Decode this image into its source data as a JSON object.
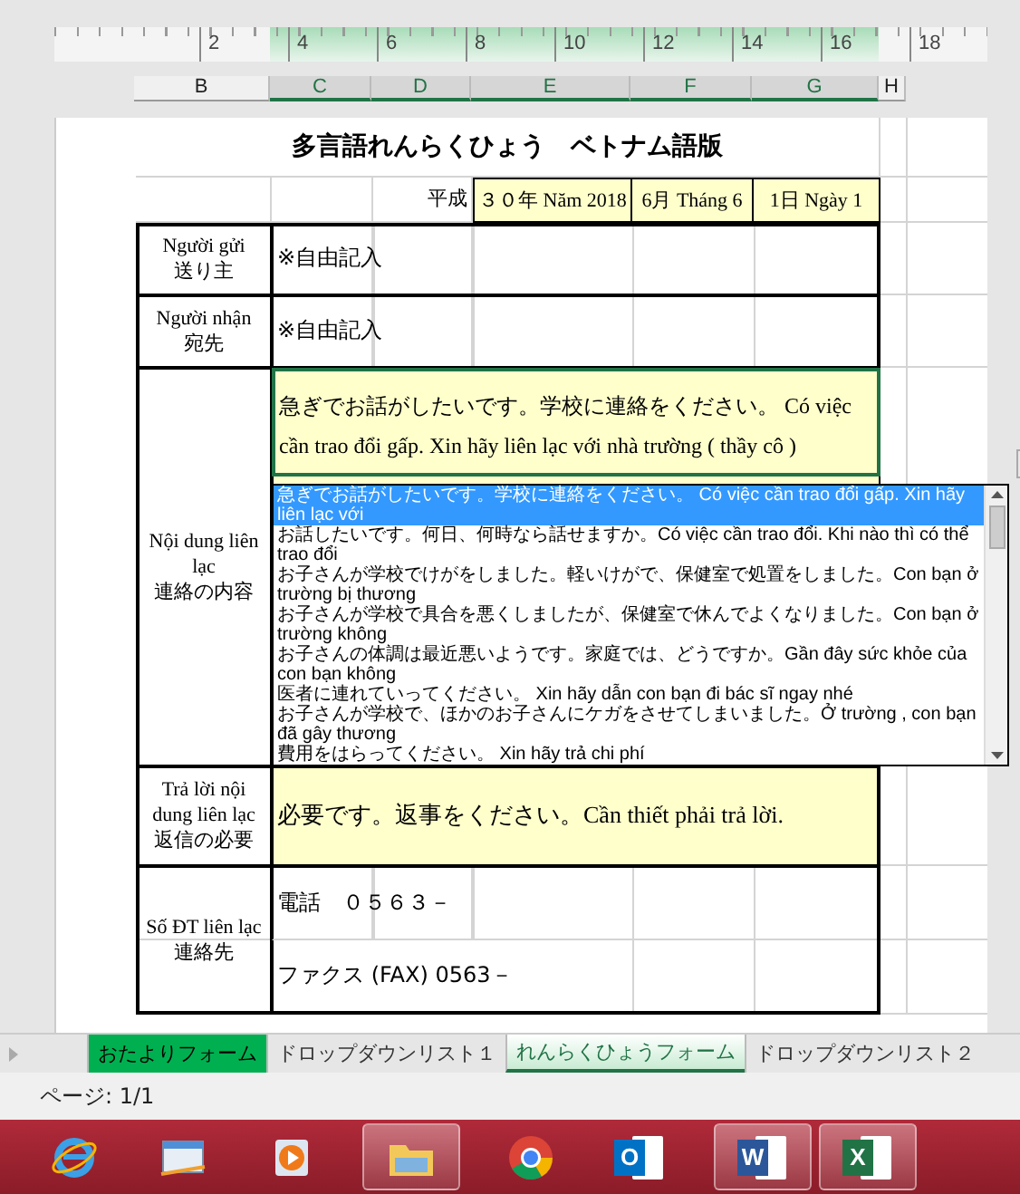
{
  "ruler": {
    "numbers": [
      "2",
      "4",
      "6",
      "8",
      "10",
      "12",
      "14",
      "16",
      "18"
    ]
  },
  "column_headers": [
    {
      "label": "B",
      "selected": false
    },
    {
      "label": "C",
      "selected": true
    },
    {
      "label": "D",
      "selected": true
    },
    {
      "label": "E",
      "selected": true
    },
    {
      "label": "F",
      "selected": true
    },
    {
      "label": "G",
      "selected": true
    },
    {
      "label": "H",
      "selected": false
    }
  ],
  "form": {
    "title": "多言語れんらくひょう　ベトナム語版",
    "date": {
      "era": "平成",
      "year": "３０年 Năm 2018",
      "month": "6月 Tháng 6",
      "day": "1日 Ngày 1"
    },
    "sender": {
      "label": "Người  gửi",
      "label_ja": "送り主",
      "value": "※自由記入"
    },
    "recipient": {
      "label": "Người nhận",
      "label_ja": "宛先",
      "value": "※自由記入"
    },
    "content": {
      "label": "Nội dung liên lạc",
      "label_ja": "連絡の内容",
      "value": "急ぎでお話がしたいです。学校に連絡をください。 Có việc cần trao đổi gấp. Xin hãy liên lạc với nhà trường ( thầy cô )",
      "dropdown": [
        {
          "text": "急ぎでお話がしたいです。学校に連絡をください。 Có việc cần trao đổi gấp. Xin hãy liên lạc với",
          "selected": true
        },
        {
          "text": "お話したいです。何日、何時なら話せますか。Có việc cần trao đổi. Khi nào thì có thể trao đổi",
          "selected": false
        },
        {
          "text": "お子さんが学校でけがをしました。軽いけがで、保健室で処置をしました。Con bạn ở trường bị thương",
          "selected": false
        },
        {
          "text": "お子さんが学校で具合を悪くしましたが、保健室で休んでよくなりました。Con bạn ở trường không",
          "selected": false
        },
        {
          "text": "お子さんの体調は最近悪いようです。家庭では、どうですか。Gần đây sức khỏe của con bạn không",
          "selected": false
        },
        {
          "text": "医者に連れていってください。 Xin hãy dẫn con bạn đi bác sĩ  ngay nhé",
          "selected": false
        },
        {
          "text": "お子さんが学校で、ほかのお子さんにケガをさせてしまいました。Ở trường , con bạn đã gây thương",
          "selected": false
        },
        {
          "text": "費用をはらってください。 Xin hãy trả chi phí",
          "selected": false
        }
      ]
    },
    "reply": {
      "label": "Trả lời nội dung liên lạc",
      "label_ja": "返信の必要",
      "value": "必要です。返事をください。Cần thiết phải trả lời."
    },
    "contact": {
      "label": "Số ĐT liên lạc",
      "label_ja": "連絡先",
      "phone": "電話　０５６３－",
      "fax": "ファクス (FAX)  0563－"
    }
  },
  "sheet_tabs": [
    {
      "label": "おたよりフォーム",
      "selected": false,
      "color": "#00b050"
    },
    {
      "label": "ドロップダウンリスト１",
      "selected": false
    },
    {
      "label": "れんらくひょうフォーム",
      "selected": true
    },
    {
      "label": "ドロップダウンリスト２",
      "selected": false
    }
  ],
  "status_bar": {
    "page": "ページ: 1/1"
  },
  "taskbar": [
    {
      "kind": "ie",
      "active": false
    },
    {
      "kind": "mail",
      "active": false
    },
    {
      "kind": "media",
      "active": false
    },
    {
      "kind": "folder",
      "active": true
    },
    {
      "kind": "chrome",
      "active": false
    },
    {
      "kind": "outlook",
      "letter": "O",
      "active": false
    },
    {
      "kind": "word",
      "letter": "W",
      "active": true
    },
    {
      "kind": "excel",
      "letter": "X",
      "active": true
    }
  ]
}
